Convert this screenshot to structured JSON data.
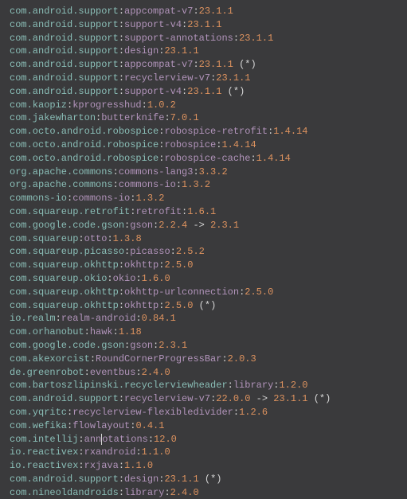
{
  "lines": [
    {
      "pkg": "com.android.support",
      "artifact": "appcompat-v7",
      "version": "23.1.1"
    },
    {
      "pkg": "com.android.support",
      "artifact": "support-v4",
      "version": "23.1.1"
    },
    {
      "pkg": "com.android.support",
      "artifact": "support-annotations",
      "version": "23.1.1"
    },
    {
      "pkg": "com.android.support",
      "artifact": "design",
      "version": "23.1.1"
    },
    {
      "pkg": "com.android.support",
      "artifact": "appcompat-v7",
      "version": "23.1.1",
      "star": true
    },
    {
      "pkg": "com.android.support",
      "artifact": "recyclerview-v7",
      "version": "23.1.1"
    },
    {
      "pkg": "com.android.support",
      "artifact": "support-v4",
      "version": "23.1.1",
      "star": true
    },
    {
      "pkg": "com.kaopiz",
      "artifact": "kprogresshud",
      "version": "1.0.2"
    },
    {
      "pkg": "com.jakewharton",
      "artifact": "butterknife",
      "version": "7.0.1"
    },
    {
      "pkg": "com.octo.android.robospice",
      "artifact": "robospice-retrofit",
      "version": "1.4.14"
    },
    {
      "pkg": "com.octo.android.robospice",
      "artifact": "robospice",
      "version": "1.4.14"
    },
    {
      "pkg": "com.octo.android.robospice",
      "artifact": "robospice-cache",
      "version": "1.4.14"
    },
    {
      "pkg": "org.apache.commons",
      "artifact": "commons-lang3",
      "version": "3.3.2"
    },
    {
      "pkg": "org.apache.commons",
      "artifact": "commons-io",
      "version": "1.3.2"
    },
    {
      "pkg": "commons-io",
      "artifact": "commons-io",
      "version": "1.3.2"
    },
    {
      "pkg": "com.squareup.retrofit",
      "artifact": "retrofit",
      "version": "1.6.1"
    },
    {
      "pkg": "com.google.code.gson",
      "artifact": "gson",
      "version": "2.2.4",
      "upgrade": "2.3.1"
    },
    {
      "pkg": "com.squareup",
      "artifact": "otto",
      "version": "1.3.8"
    },
    {
      "pkg": "com.squareup.picasso",
      "artifact": "picasso",
      "version": "2.5.2"
    },
    {
      "pkg": "com.squareup.okhttp",
      "artifact": "okhttp",
      "version": "2.5.0"
    },
    {
      "pkg": "com.squareup.okio",
      "artifact": "okio",
      "version": "1.6.0"
    },
    {
      "pkg": "com.squareup.okhttp",
      "artifact": "okhttp-urlconnection",
      "version": "2.5.0"
    },
    {
      "pkg": "com.squareup.okhttp",
      "artifact": "okhttp",
      "version": "2.5.0",
      "star": true
    },
    {
      "pkg": "io.realm",
      "artifact": "realm-android",
      "version": "0.84.1"
    },
    {
      "pkg": "com.orhanobut",
      "artifact": "hawk",
      "version": "1.18"
    },
    {
      "pkg": "com.google.code.gson",
      "artifact": "gson",
      "version": "2.3.1"
    },
    {
      "pkg": "com.akexorcist",
      "artifact": "RoundCornerProgressBar",
      "version": "2.0.3"
    },
    {
      "pkg": "de.greenrobot",
      "artifact": "eventbus",
      "version": "2.4.0"
    },
    {
      "pkg": "com.bartoszlipinski.recyclerviewheader",
      "artifact": "library",
      "version": "1.2.0"
    },
    {
      "pkg": "com.android.support",
      "artifact": "recyclerview-v7",
      "version": "22.0.0",
      "upgrade": "23.1.1",
      "star": true
    },
    {
      "pkg": "com.yqritc",
      "artifact": "recyclerview-flexibledivider",
      "version": "1.2.6"
    },
    {
      "pkg": "com.wefika",
      "artifact": "flowlayout",
      "version": "0.4.1"
    },
    {
      "pkg": "com.intellij",
      "artifact": "annotations",
      "version": "12.0",
      "cursor": 3
    },
    {
      "pkg": "io.reactivex",
      "artifact": "rxandroid",
      "version": "1.1.0"
    },
    {
      "pkg": "io.reactivex",
      "artifact": "rxjava",
      "version": "1.1.0"
    },
    {
      "pkg": "com.android.support",
      "artifact": "design",
      "version": "23.1.1",
      "star": true
    },
    {
      "pkg": "com.nineoldandroids",
      "artifact": "library",
      "version": "2.4.0"
    }
  ]
}
